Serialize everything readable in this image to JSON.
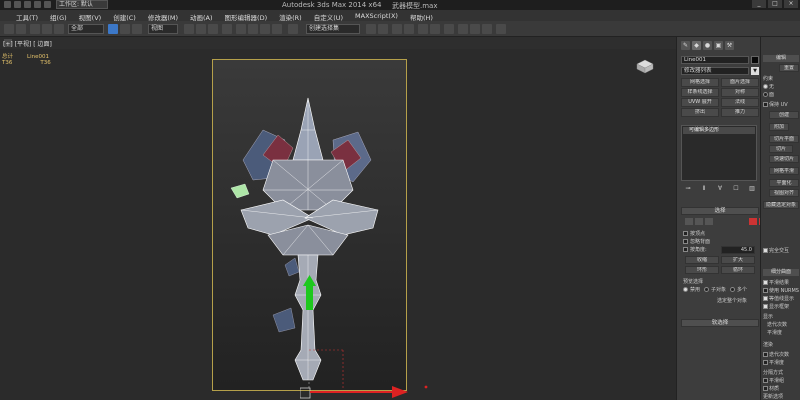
{
  "titlebar": {
    "workspace": "工作区: 默认",
    "app_title": "Autodesk 3ds Max  2014 x64",
    "file_name": "武器模型.max",
    "min": "_",
    "max": "□",
    "close": "×"
  },
  "menu": [
    "工具(T)",
    "组(G)",
    "视图(V)",
    "创建(C)",
    "修改器(M)",
    "动画(A)",
    "图形编辑器(D)",
    "渲染(R)",
    "自定义(U)",
    "MAXScript(X)",
    "帮助(H)"
  ],
  "toolbar": {
    "filter": "全部",
    "refsys": "视图",
    "selset": "创建选择集"
  },
  "viewport": {
    "label": "[+] [平视] [ 边面]",
    "stats_label": "总计",
    "stats_obj": "Line001",
    "stats_a": "T36",
    "stats_b": "T36"
  },
  "command": {
    "tabs": [
      "✎",
      "◆",
      "●",
      "▣",
      "⚒"
    ],
    "object_name": "Line001",
    "modifier_list": "修改器列表",
    "mod_buttons": [
      "网格选择",
      "面片选择",
      "样条线选择",
      "对称",
      "UVW 展开",
      "法线",
      "挤出",
      "推力"
    ],
    "stack_item": "可编辑多边形",
    "stack_icons": [
      "⊸",
      "Ⅱ",
      "∀",
      "☐",
      "▥"
    ],
    "selection_title": "选择",
    "chk_by_vertex": "按顶点",
    "chk_ignore_back": "忽略背面",
    "chk_by_angle": "按角度:",
    "angle_value": "45.0",
    "btn_shrink": "收缩",
    "btn_grow": "扩大",
    "btn_ring": "环形",
    "btn_loop": "循环",
    "preview_title": "预览选择",
    "radio_disabled": "禁用",
    "radio_subobj": "子对象",
    "radio_multi": "多个",
    "selected_info": "选定整个对象",
    "soft_sel": "软选择"
  },
  "rpanel": {
    "edit_title": "编辑",
    "reset": "重置",
    "constraint": "约束",
    "none": "无",
    "face": "面",
    "keep_uv": "保持 UV",
    "create": "创建",
    "attach": "附加",
    "slice_plane": "切片平面",
    "slice": "切片",
    "quickslice": "快速切片",
    "mesh_smooth": "网格平滑",
    "planarize": "平面化",
    "view_align": "视图对齐",
    "hide_sel": "隐藏选定对象",
    "full_interactive": "完全交互",
    "subdivision": "细分曲面",
    "smooth_result": "平滑结果",
    "use_nurms": "使用 NURMS",
    "iso_display": "等值线显示",
    "show_cage": "显示框架",
    "display": "显示",
    "iterations": "迭代次数",
    "smoothness": "平滑度",
    "render": "渲染",
    "sep_by": "分隔方式",
    "smooth_groups": "平滑组",
    "material": "材质",
    "update_opts": "更新选项"
  }
}
